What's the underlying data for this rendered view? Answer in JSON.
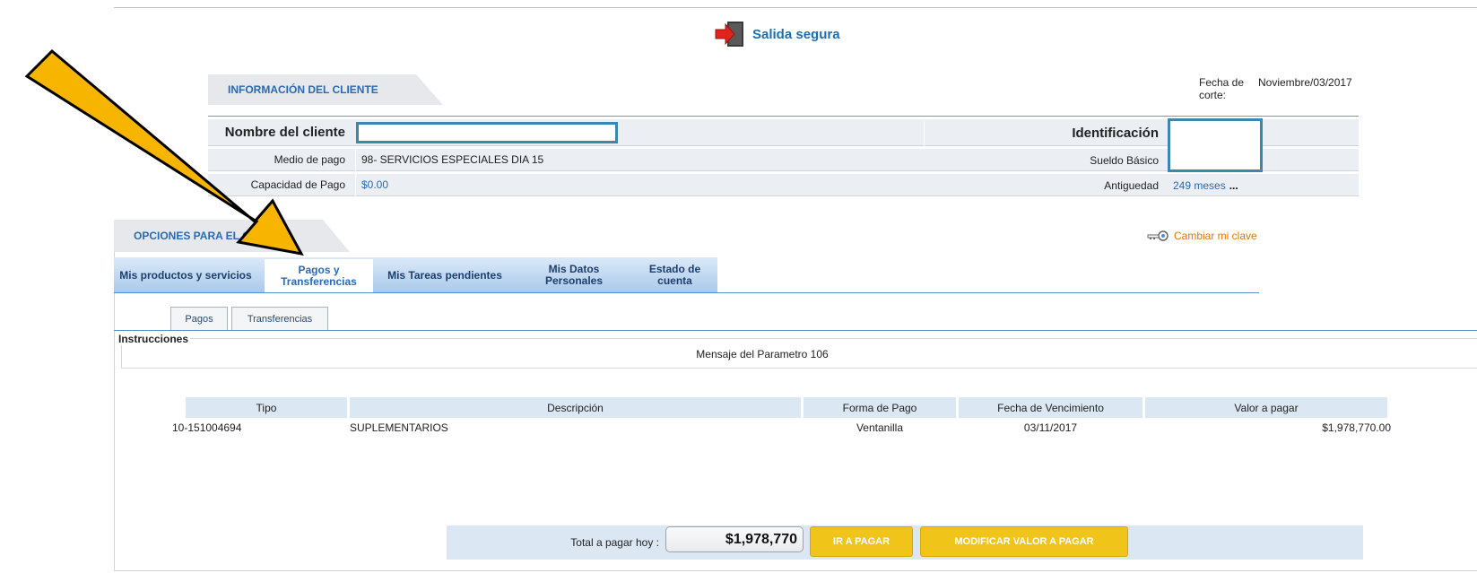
{
  "header": {
    "logout_label": "Salida segura"
  },
  "client_info": {
    "section_title": "INFORMACIÓN DEL CLIENTE",
    "cutoff_label": "Fecha de corte:",
    "cutoff_value": "Noviembre/03/2017",
    "name_label": "Nombre del cliente",
    "id_label": "Identificación",
    "payment_method_label": "Medio de pago",
    "payment_method_value": "98- SERVICIOS ESPECIALES DIA 15",
    "base_salary_label": "Sueldo Básico",
    "capacity_label": "Capacidad de Pago",
    "capacity_value": "$0.00",
    "seniority_label": "Antiguedad",
    "seniority_value": "249 meses",
    "seniority_more": "..."
  },
  "options": {
    "section_title": "OPCIONES PARA EL CLIENTE",
    "change_password": "Cambiar mi clave",
    "tabs": [
      {
        "label": "Mis productos y servicios"
      },
      {
        "label": "Pagos y Transferencias"
      },
      {
        "label": "Mis Tareas pendientes"
      },
      {
        "label": "Mis Datos Personales"
      },
      {
        "label": "Estado de cuenta"
      }
    ],
    "subtabs": [
      {
        "label": "Pagos"
      },
      {
        "label": "Transferencias"
      }
    ]
  },
  "instructions": {
    "legend": "Instrucciones",
    "message": "Mensaje del Parametro 106"
  },
  "table": {
    "headers": [
      "Tipo",
      "Descripción",
      "Forma de Pago",
      "Fecha de Vencimiento",
      "Valor a pagar"
    ],
    "rows": [
      {
        "tipo": "10-151004694",
        "descripcion": "SUPLEMENTARIOS",
        "forma": "Ventanilla",
        "fecha": "03/11/2017",
        "valor": "$1,978,770.00"
      }
    ]
  },
  "total": {
    "label": "Total a pagar hoy :",
    "value": "$1,978,770",
    "pay_button": "IR A PAGAR",
    "modify_button": "MODIFICAR VALOR A PAGAR"
  },
  "colors": {
    "accent": "#2a6ab1",
    "button": "#f0c419",
    "link_orange": "#e57800",
    "arrow": "#f7b500"
  }
}
